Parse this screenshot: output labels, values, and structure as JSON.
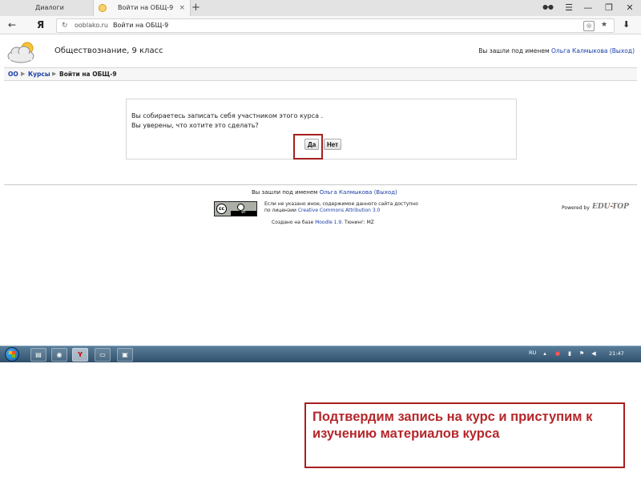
{
  "browser": {
    "tabs": [
      {
        "label": "Диалоги",
        "active": false
      },
      {
        "label": "Войти на ОБЩ-9",
        "active": true
      }
    ],
    "tab_close": "×",
    "new_tab": "+",
    "controls": {
      "menu": "☰",
      "minimize": "—",
      "maximize": "❐",
      "close": "✕"
    },
    "back": "←",
    "yandex": "Я",
    "reload": "↻",
    "address_domain": "ooblako.ru",
    "address_title": "Войти на ОБЩ-9",
    "star": "★",
    "download": "⬇"
  },
  "header": {
    "course_title": "Обществознание, 9 класс",
    "login_prefix": "Вы зашли под именем",
    "user_name": "Ольга Калмыкова",
    "logout": "(Выход)"
  },
  "breadcrumb": {
    "items": [
      "ОО",
      "Курсы",
      "Войти на ОБЩ-9"
    ],
    "separator": "▶"
  },
  "notice": {
    "line1": "Вы собираетесь записать себя участником этого курса .",
    "line2": "Вы уверены, что хотите это сделать?",
    "yes_label": "Да",
    "no_label": "Нет"
  },
  "footer": {
    "login_prefix": "Вы зашли под именем",
    "user_name": "Ольга Калмыкова",
    "logout": "(Выход)",
    "license_prefix": "Если не указано иное, содержимое данного сайта доступно по лицензии",
    "license_link": "Creative Commons Attribution 3.0",
    "created_prefix": "Создано на базе",
    "moodle_link": "Moodle 1.9.",
    "created_suffix": "Тюнинг: MZ",
    "cc_mark": "cc",
    "cc_by": "BY",
    "powered_by": "Powered by",
    "brand_left": "EDU",
    "brand_dash": "-",
    "brand_right": "TOP"
  },
  "taskbar": {
    "buttons": [
      "explorer",
      "chrome",
      "Y",
      "folder",
      "pdf"
    ],
    "language": "RU",
    "time": "21:47"
  },
  "caption": {
    "text": "Подтвердим запись на курс и приступим к изучению материалов курса"
  },
  "colors": {
    "link": "#1a3ea8",
    "highlight_border": "#a81f1f",
    "caption_text": "#b5272b"
  }
}
